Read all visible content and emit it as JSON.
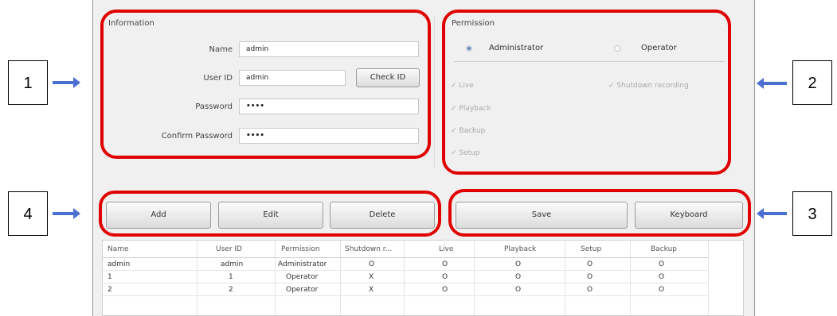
{
  "information": {
    "title": "Information",
    "name_label": "Name",
    "name_value": "admin",
    "userid_label": "User ID",
    "userid_value": "admin",
    "check_id_button": "Check ID",
    "password_label": "Password",
    "password_value": "••••",
    "confirm_label": "Confirm Password",
    "confirm_value": "••••"
  },
  "permission": {
    "title": "Permission",
    "administrator": "Administrator",
    "operator": "Operator",
    "selected": "Administrator",
    "items": [
      "Live",
      "Playback",
      "Backup",
      "Setup"
    ],
    "shutdown": "Shutdown recording"
  },
  "buttons": {
    "add": "Add",
    "edit": "Edit",
    "delete": "Delete",
    "save": "Save",
    "keyboard": "Keyboard"
  },
  "table": {
    "headers": [
      "Name",
      "User ID",
      "Permission",
      "Shutdown r...",
      "Live",
      "Playback",
      "Setup",
      "Backup"
    ],
    "rows": [
      [
        "admin",
        "admin",
        "Administrator",
        "O",
        "O",
        "O",
        "O",
        "O"
      ],
      [
        "1",
        "1",
        "Operator",
        "X",
        "O",
        "O",
        "O",
        "O"
      ],
      [
        "2",
        "2",
        "Operator",
        "X",
        "O",
        "O",
        "O",
        "O"
      ]
    ]
  },
  "callouts": [
    "1",
    "2",
    "3",
    "4"
  ],
  "colors": {
    "highlight": "#e10000",
    "arrow": "#4a6fd1"
  }
}
